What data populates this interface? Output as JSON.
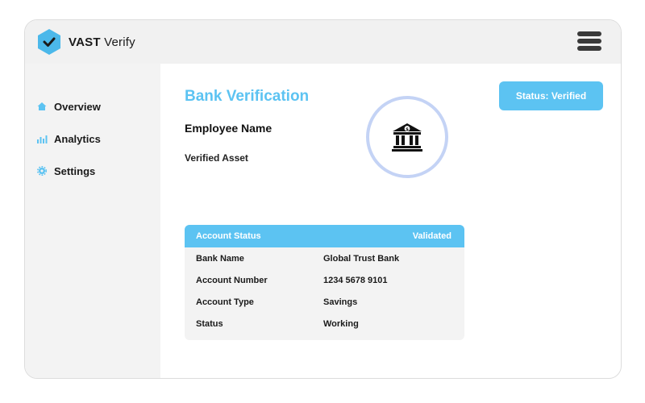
{
  "header": {
    "logo_bold": "VAST",
    "logo_light": "Verify",
    "menu_icon": "hamburger-menu-icon"
  },
  "sidebar": {
    "items": [
      {
        "label": "Overview",
        "icon": "home-icon"
      },
      {
        "label": "Analytics",
        "icon": "bar-chart-icon"
      },
      {
        "label": "Settings",
        "icon": "gear-icon"
      }
    ]
  },
  "main": {
    "title": "Bank Verification",
    "employee_name": "Employee Name",
    "verified_asset": "Verified Asset",
    "status_button": "Status: Verified",
    "bank_icon": "bank-icon"
  },
  "account_card": {
    "header_left": "Account Status",
    "header_right": "Validated",
    "rows": [
      {
        "label": "Bank Name",
        "value": "Global Trust Bank"
      },
      {
        "label": "Account Number",
        "value": "1234 5678 9101"
      },
      {
        "label": "Account Type",
        "value": "Savings"
      },
      {
        "label": "Status",
        "value": "Working"
      }
    ]
  },
  "colors": {
    "accent": "#5cc3f2",
    "logo_hex": "#4bb8ea",
    "circle_border": "#c4d3f5",
    "sidebar_bg": "#f3f3f3",
    "header_bg": "#f1f1f1"
  }
}
